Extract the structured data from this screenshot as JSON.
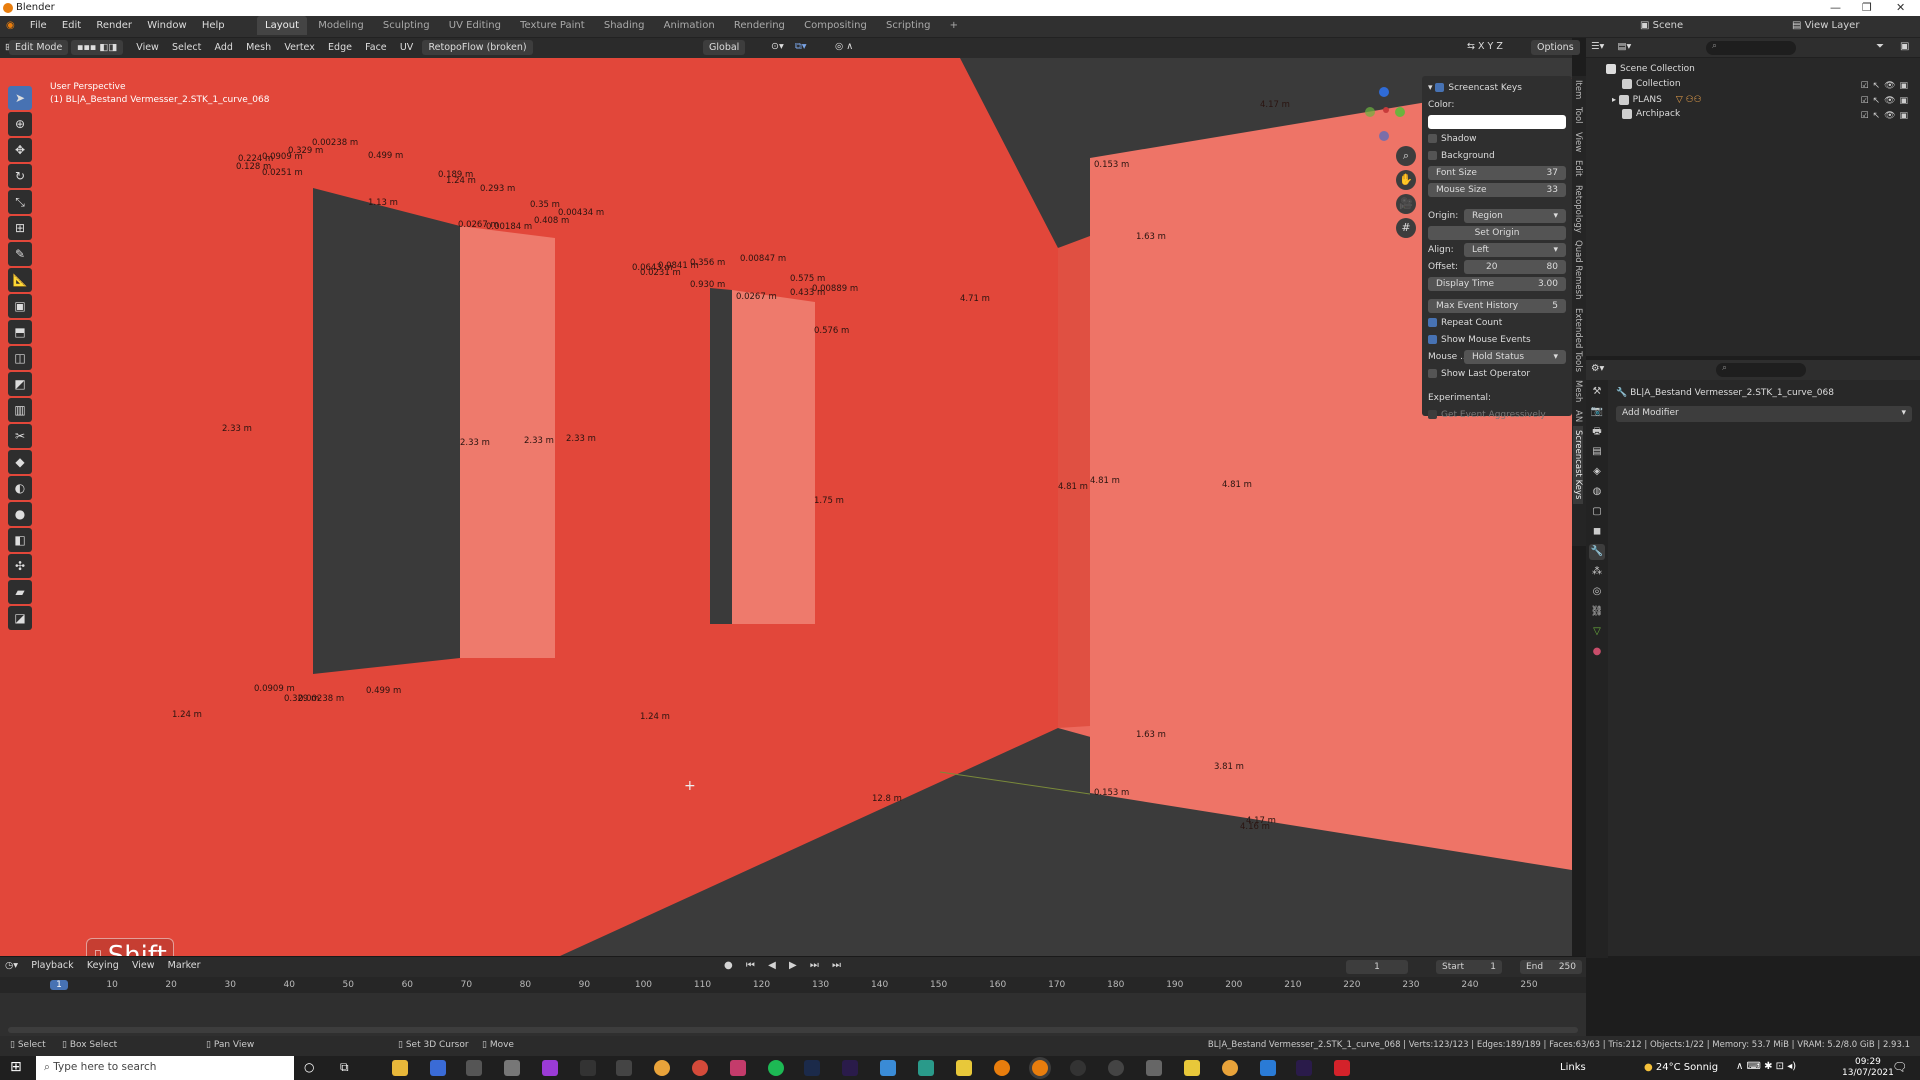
{
  "window": {
    "title": "Blender"
  },
  "menu": [
    "File",
    "Edit",
    "Render",
    "Window",
    "Help"
  ],
  "workspaces": [
    "Layout",
    "Modeling",
    "Sculpting",
    "UV Editing",
    "Texture Paint",
    "Shading",
    "Animation",
    "Rendering",
    "Compositing",
    "Scripting",
    "+"
  ],
  "scene": {
    "label": "Scene",
    "view_layer": "View Layer"
  },
  "viewport_header": {
    "mode": "Edit Mode",
    "menus": [
      "View",
      "Select",
      "Add",
      "Mesh",
      "Vertex",
      "Edge",
      "Face",
      "UV"
    ],
    "addon": "RetopoFlow (broken)",
    "orientation": "Global",
    "options": "Options"
  },
  "overlay": {
    "perspective": "User Perspective",
    "object": "(1) BL|A_Bestand Vermesser_2.STK_1_curve_068"
  },
  "dimensions": [
    "0.00238 m",
    "0.329 m",
    "0.0909 m",
    "0.224 m",
    "0.128 m",
    "0.0251 m",
    "0.499 m",
    "0.189 m",
    "1.24 m",
    "0.293 m",
    "0.35 m",
    "0.00434 m",
    "0.0267 m",
    "0.408 m",
    "0.00184 m",
    "1.13 m",
    "0.00847 m",
    "0.356 m",
    "0.0841 m",
    "0.0643 m",
    "0.0231 m",
    "0.930 m",
    "0.575 m",
    "0.433 m",
    "0.00889 m",
    "0.0267 m",
    "0.576 m",
    "4.71 m",
    "1.63 m",
    "0.153 m",
    "2.33 m",
    "2.33 m",
    "2.33 m",
    "2.33 m",
    "1.75 m",
    "4.81 m",
    "4.81 m",
    "4.81 m",
    "3.81 m",
    "4.17 m",
    "4.16 m",
    "4.17 m",
    "1.63 m",
    "0.153 m",
    "12.8 m",
    "1.24 m",
    "1.24 m",
    "0.499 m",
    "0.00238 m",
    "0.329 m",
    "0.0909 m"
  ],
  "screencast_keys": {
    "title": "Screencast Keys",
    "color_label": "Color:",
    "shadow": "Shadow",
    "background": "Background",
    "font_size_label": "Font Size",
    "font_size": "37",
    "mouse_size_label": "Mouse Size",
    "mouse_size": "33",
    "origin_label": "Origin:",
    "origin": "Region",
    "set_origin": "Set Origin",
    "align_label": "Align:",
    "align": "Left",
    "offset_label": "Offset:",
    "offset_x": "20",
    "offset_y": "80",
    "display_time_label": "Display Time",
    "display_time": "3.00",
    "max_history_label": "Max Event History",
    "max_history": "5",
    "repeat_count": "Repeat Count",
    "show_mouse_events": "Show Mouse Events",
    "mouse_label": "Mouse ...",
    "mouse_value": "Hold Status",
    "show_last_operator": "Show Last Operator",
    "experimental": "Experimental:",
    "get_event_aggr": "Get Event Aggressively"
  },
  "side_tabs": [
    "Item",
    "Tool",
    "View",
    "Edit",
    "Retopology",
    "Quad Remesh",
    "Extended Tools",
    "Mesh",
    "AN",
    "Screencast Keys"
  ],
  "outliner": {
    "root": "Scene Collection",
    "rows": [
      "Collection",
      "PLANS",
      "Archipack"
    ]
  },
  "properties": {
    "object": "BL|A_Bestand Vermesser_2.STK_1_curve_068",
    "add_modifier": "Add Modifier"
  },
  "shift_key": "Shift",
  "timeline": {
    "menus": [
      "Playback",
      "Keying",
      "View",
      "Marker"
    ],
    "current": "1",
    "start_label": "Start",
    "start": "1",
    "end_label": "End",
    "end": "250",
    "ticks": [
      "1",
      "10",
      "20",
      "30",
      "40",
      "50",
      "60",
      "70",
      "80",
      "90",
      "100",
      "110",
      "120",
      "130",
      "140",
      "150",
      "160",
      "170",
      "180",
      "190",
      "200",
      "210",
      "220",
      "230",
      "240",
      "250"
    ]
  },
  "statusbar": {
    "left": [
      "Select",
      "Box Select",
      "Pan View",
      "Set 3D Cursor",
      "Move"
    ],
    "right": "BL|A_Bestand Vermesser_2.STK_1_curve_068 | Verts:123/123 | Edges:189/189 | Faces:63/63 | Tris:212 | Objects:1/22 | Memory: 53.7 MiB | VRAM: 5.2/8.0 GiB | 2.93.1"
  },
  "taskbar": {
    "search": "Type here to search",
    "weather": "24°C Sonnig",
    "lang": "Links",
    "time": "09:29",
    "date": "13/07/2021"
  },
  "colors": {
    "wall_red": "#e2473a",
    "accent_blue": "#4772b3",
    "ui_dark": "#2b2b2b"
  }
}
